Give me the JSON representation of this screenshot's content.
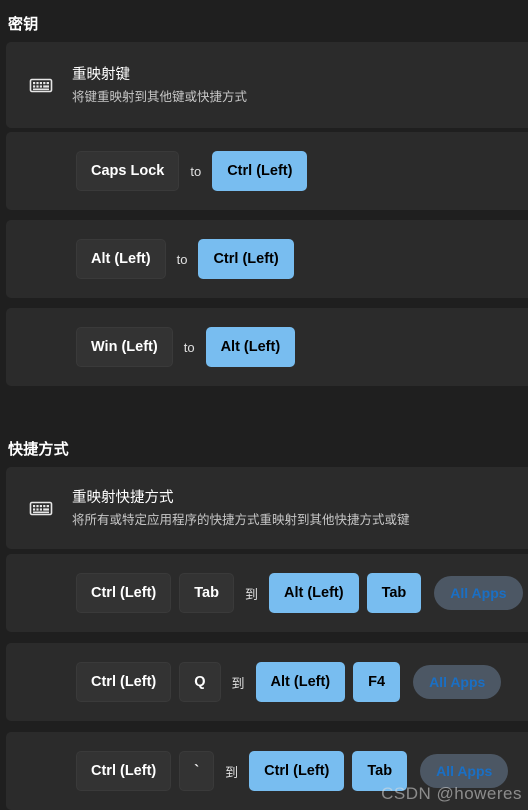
{
  "sections": [
    {
      "title": "密钥",
      "header": {
        "icon": "keyboard-icon",
        "title": "重映射键",
        "subtitle": "将键重映射到其他键或快捷方式"
      },
      "rows": [
        {
          "source": [
            "Caps Lock"
          ],
          "separator": "to",
          "target": [
            "Ctrl (Left)"
          ]
        },
        {
          "source": [
            "Alt (Left)"
          ],
          "separator": "to",
          "target": [
            "Ctrl (Left)"
          ]
        },
        {
          "source": [
            "Win (Left)"
          ],
          "separator": "to",
          "target": [
            "Alt (Left)"
          ]
        }
      ]
    },
    {
      "title": "快捷方式",
      "header": {
        "icon": "keyboard-icon",
        "title": "重映射快捷方式",
        "subtitle": "将所有或特定应用程序的快捷方式重映射到其他快捷方式或键"
      },
      "rows": [
        {
          "source": [
            "Ctrl (Left)",
            "Tab"
          ],
          "separator": "到",
          "target": [
            "Alt (Left)",
            "Tab"
          ],
          "scope": "All Apps"
        },
        {
          "source": [
            "Ctrl (Left)",
            "Q"
          ],
          "separator": "到",
          "target": [
            "Alt (Left)",
            "F4"
          ],
          "scope": "All Apps"
        },
        {
          "source": [
            "Ctrl (Left)",
            "`"
          ],
          "separator": "到",
          "target": [
            "Ctrl (Left)",
            "Tab"
          ],
          "scope": "All Apps"
        }
      ]
    }
  ],
  "watermark": "CSDN @howeres",
  "colors": {
    "background": "#1f1f1f",
    "card": "#2b2b2b",
    "source_key": "#333333",
    "target_key": "#78bdf0",
    "scope_pill_bg": "#4c5764",
    "scope_pill_text": "#1a6fc4"
  }
}
